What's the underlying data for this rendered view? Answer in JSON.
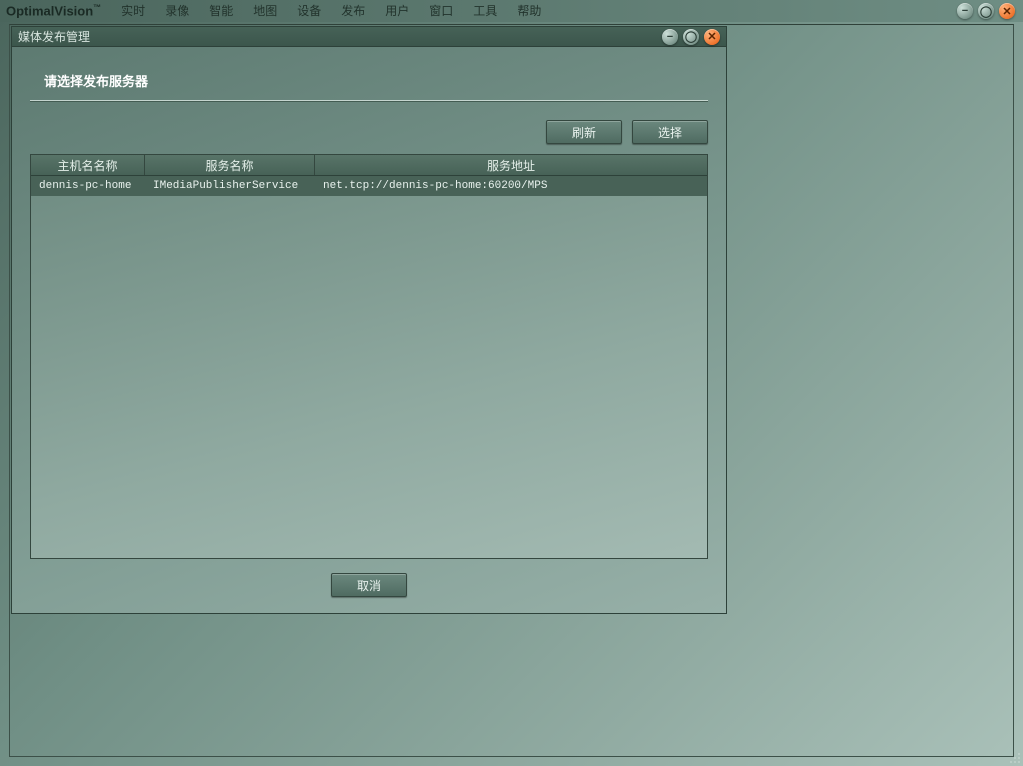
{
  "app": {
    "brand": "OptimalVision",
    "tm": "™"
  },
  "menu": {
    "items": [
      "实时",
      "录像",
      "智能",
      "地图",
      "设备",
      "发布",
      "用户",
      "窗口",
      "工具",
      "帮助"
    ]
  },
  "main_window_controls": {
    "min": "−",
    "max": "○",
    "close": "×"
  },
  "child": {
    "title": "媒体发布管理",
    "controls": {
      "min": "−",
      "max": "○",
      "close": "×"
    },
    "section_title": "请选择发布服务器",
    "buttons": {
      "refresh": "刷新",
      "select": "选择",
      "cancel": "取消"
    },
    "table": {
      "headers": {
        "host": "主机名名称",
        "service": "服务名称",
        "address": "服务地址"
      },
      "rows": [
        {
          "host": "dennis-pc-home",
          "service": "IMediaPublisherService",
          "address": "net.tcp://dennis-pc-home:60200/MPS",
          "selected": true
        }
      ]
    }
  }
}
